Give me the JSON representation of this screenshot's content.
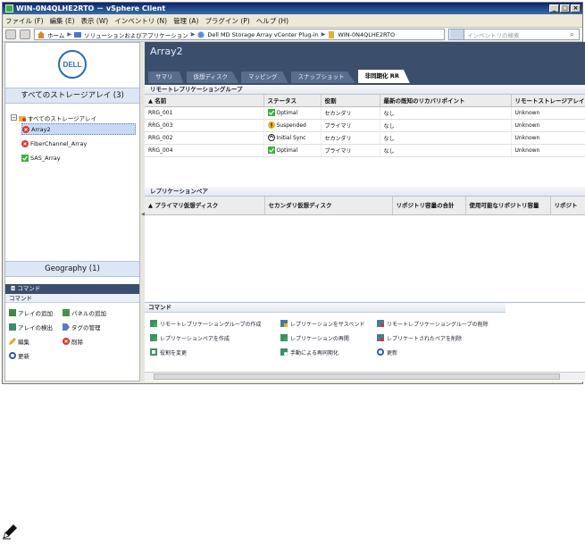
{
  "window": {
    "title": "WIN-0N4QLHE2RTO － vSphere Client"
  },
  "menu": [
    "ファイル (F)",
    "編集 (E)",
    "表示 (W)",
    "インベントリ (N)",
    "管理 (A)",
    "プラグイン (P)",
    "ヘルプ (H)"
  ],
  "breadcrumb": [
    "ホーム",
    "ソリューションおよびアプリケーション",
    "Dell MD Storage Array vCenter Plug-in",
    "WIN-0N4QLHE2RTO"
  ],
  "search": {
    "placeholder": "インベントリの検索"
  },
  "left": {
    "logo": "DELL",
    "arrays_header": "すべてのストレージアレイ (3)",
    "tree_root": "すべてのストレージアレイ",
    "tree_items": [
      "Array2",
      "FiberChannel_Array",
      "SAS_Array"
    ],
    "geography_header": "Geography (1)",
    "command_bar": "コマンド",
    "command_sub": "コマンド",
    "commands": [
      "アレイの追加",
      "パネルの追加",
      "アレイの検出",
      "タグの管理",
      "編集",
      "削除",
      "更新"
    ]
  },
  "right": {
    "title": "Array2",
    "tabs": [
      "サマリ",
      "仮想ディスク",
      "マッピング",
      "スナップショット",
      "非同期化 RR"
    ],
    "groups_section": "リモートレプリケーショングループ",
    "groups_columns": [
      "▲ 名前",
      "ステータス",
      "役割",
      "最新の既知のリカバリポイント",
      "リモートストレージアレイ"
    ],
    "groups_rows": [
      {
        "name": "RRG_001",
        "status": "Optimal",
        "role": "セカンダリ",
        "recovery": "なし",
        "remote": "Unknown"
      },
      {
        "name": "RRG_003",
        "status": "Suspended",
        "role": "プライマリ",
        "recovery": "なし",
        "remote": "Unknown"
      },
      {
        "name": "RRG_002",
        "status": "Initial Sync",
        "role": "セカンダリ",
        "recovery": "なし",
        "remote": "Unknown"
      },
      {
        "name": "RRG_004",
        "status": "Optimal",
        "role": "プライマリ",
        "recovery": "なし",
        "remote": "Unknown"
      }
    ],
    "pairs_section": "レプリケーションペア",
    "pairs_columns": [
      "▲ プライマリ仮想ディスク",
      "セカンダリ仮想ディスク",
      "リポジトリ容量の合計",
      "使用可能なリポジトリ容量",
      "リポジト"
    ],
    "commands_header": "コマンド",
    "commands": [
      "リモートレプリケーショングループの作成",
      "レプリケーションをサスペンド",
      "リモートレプリケーショングループの削除",
      "レプリケーションペアを作成",
      "レプリケーションの再開",
      "レプリケートされたペアを削除",
      "役割を変更",
      "手動による再同期化",
      "更新"
    ]
  },
  "colors": {
    "header": "#3b4e6c",
    "panel": "#dde6f4",
    "ok": "#3fae3f",
    "err": "#d9342b"
  }
}
